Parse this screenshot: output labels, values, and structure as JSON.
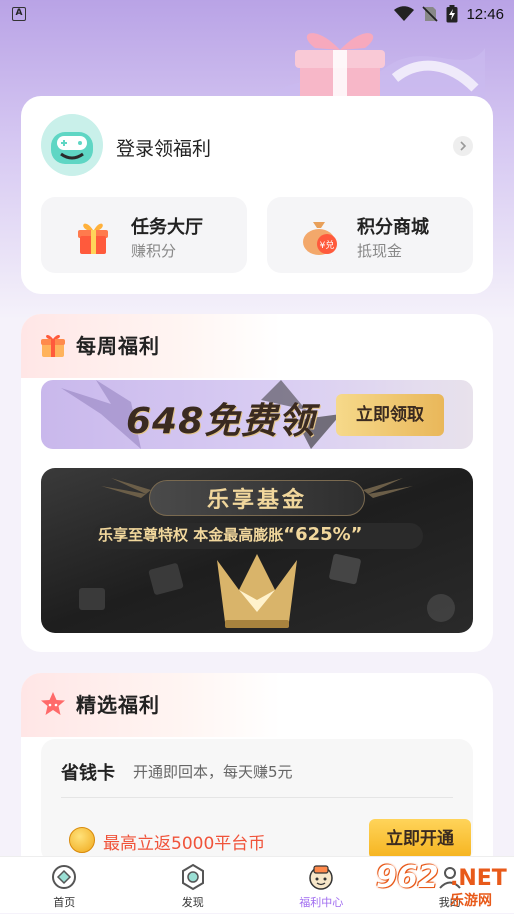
{
  "status_bar": {
    "time": "12:46",
    "app_indicator": "A"
  },
  "user_card": {
    "login_text": "登录领福利",
    "tiles": [
      {
        "title": "任务大厅",
        "subtitle": "赚积分",
        "icon": "gift-box-icon"
      },
      {
        "title": "积分商城",
        "subtitle": "抵现金",
        "icon": "money-bag-icon",
        "badge": "¥兑"
      }
    ]
  },
  "weekly": {
    "title": "每周福利",
    "banner_648": {
      "text": "648免费领",
      "button": "立即领取"
    },
    "banner_fund": {
      "title": "乐享基金",
      "subtitle_prefix": "乐享至尊特权  本金最高膨胀",
      "subtitle_pct": "“625%”"
    }
  },
  "selected": {
    "title": "精选福利",
    "card": {
      "name": "省钱卡",
      "desc": "开通即回本，每天赚5元",
      "reward": "最高立返5000平台币",
      "button": "立即开通"
    }
  },
  "tabbar": {
    "tabs": [
      {
        "label": "首页",
        "icon": "home-icon"
      },
      {
        "label": "发现",
        "icon": "discover-icon"
      },
      {
        "label": "福利中心",
        "icon": "welfare-icon",
        "active": true
      },
      {
        "label": "我的",
        "icon": "profile-icon"
      }
    ]
  },
  "watermark": {
    "number": "962",
    "net": ".NET",
    "text": "乐游网"
  },
  "colors": {
    "accent": "#a06cf0",
    "reward_red": "#f0533a",
    "gold": "#f1d79c",
    "button_yellow": "#f5b31e"
  }
}
